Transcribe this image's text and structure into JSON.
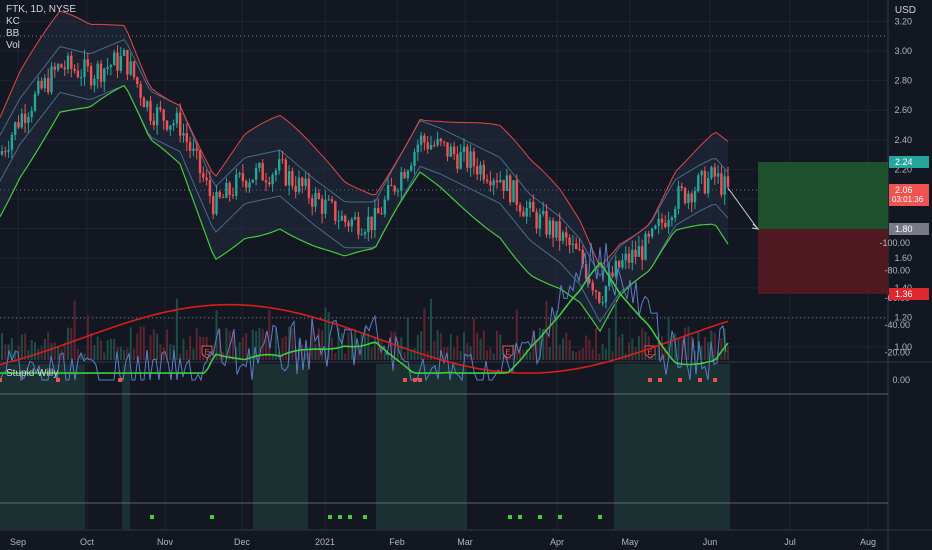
{
  "legend": {
    "symbol": "FTK, 1D, NYSE",
    "kc": "KC",
    "bb": "BB",
    "vol": "Vol"
  },
  "oscillator_label": "Stupid Willy",
  "currency": "USD",
  "price_axis": {
    "ticks": [
      "3.20",
      "3.00",
      "2.80",
      "2.60",
      "2.40",
      "2.20",
      "2.00",
      "1.80",
      "1.60",
      "1.40",
      "1.20",
      "1.00"
    ]
  },
  "osc_axis": {
    "ticks": [
      "0.00",
      "-20.00",
      "-40.00",
      "-60.00",
      "-80.00",
      "-100.00"
    ]
  },
  "time_axis": {
    "labels": [
      "Sep",
      "Oct",
      "Nov",
      "Dec",
      "2021",
      "Feb",
      "Mar",
      "Apr",
      "May",
      "Jun",
      "Jul",
      "Aug"
    ]
  },
  "price_tags": {
    "target": "2.24",
    "last_price": "2.06",
    "countdown": "03:01:36",
    "entry": "1.80",
    "stop": "1.36"
  },
  "earnings_marker": "E",
  "colors": {
    "background": "#131722",
    "up": "#26a69a",
    "down": "#ef5350",
    "bb_upper": "#e04848",
    "bb_lower": "#45c93d",
    "kc": "#4a6a8a",
    "osc_blue": "#5b7fc4",
    "osc_red": "#d81e1e",
    "osc_green": "#3ad040",
    "target_zone": "#1f5c2e",
    "stop_zone": "#5c1a22"
  },
  "chart_data": {
    "type": "candlestick",
    "x": [
      "Sep",
      "Oct",
      "Nov",
      "Dec",
      "2021",
      "Feb",
      "Mar",
      "Apr",
      "May",
      "Jun"
    ],
    "close_approx": [
      2.35,
      2.95,
      2.45,
      2.1,
      1.9,
      2.3,
      2.15,
      1.5,
      1.75,
      2.06
    ],
    "ylim": [
      0.9,
      3.25
    ],
    "osc_ylim": [
      -105,
      5
    ],
    "position": {
      "target": 2.24,
      "entry": 1.8,
      "stop": 1.36
    }
  }
}
